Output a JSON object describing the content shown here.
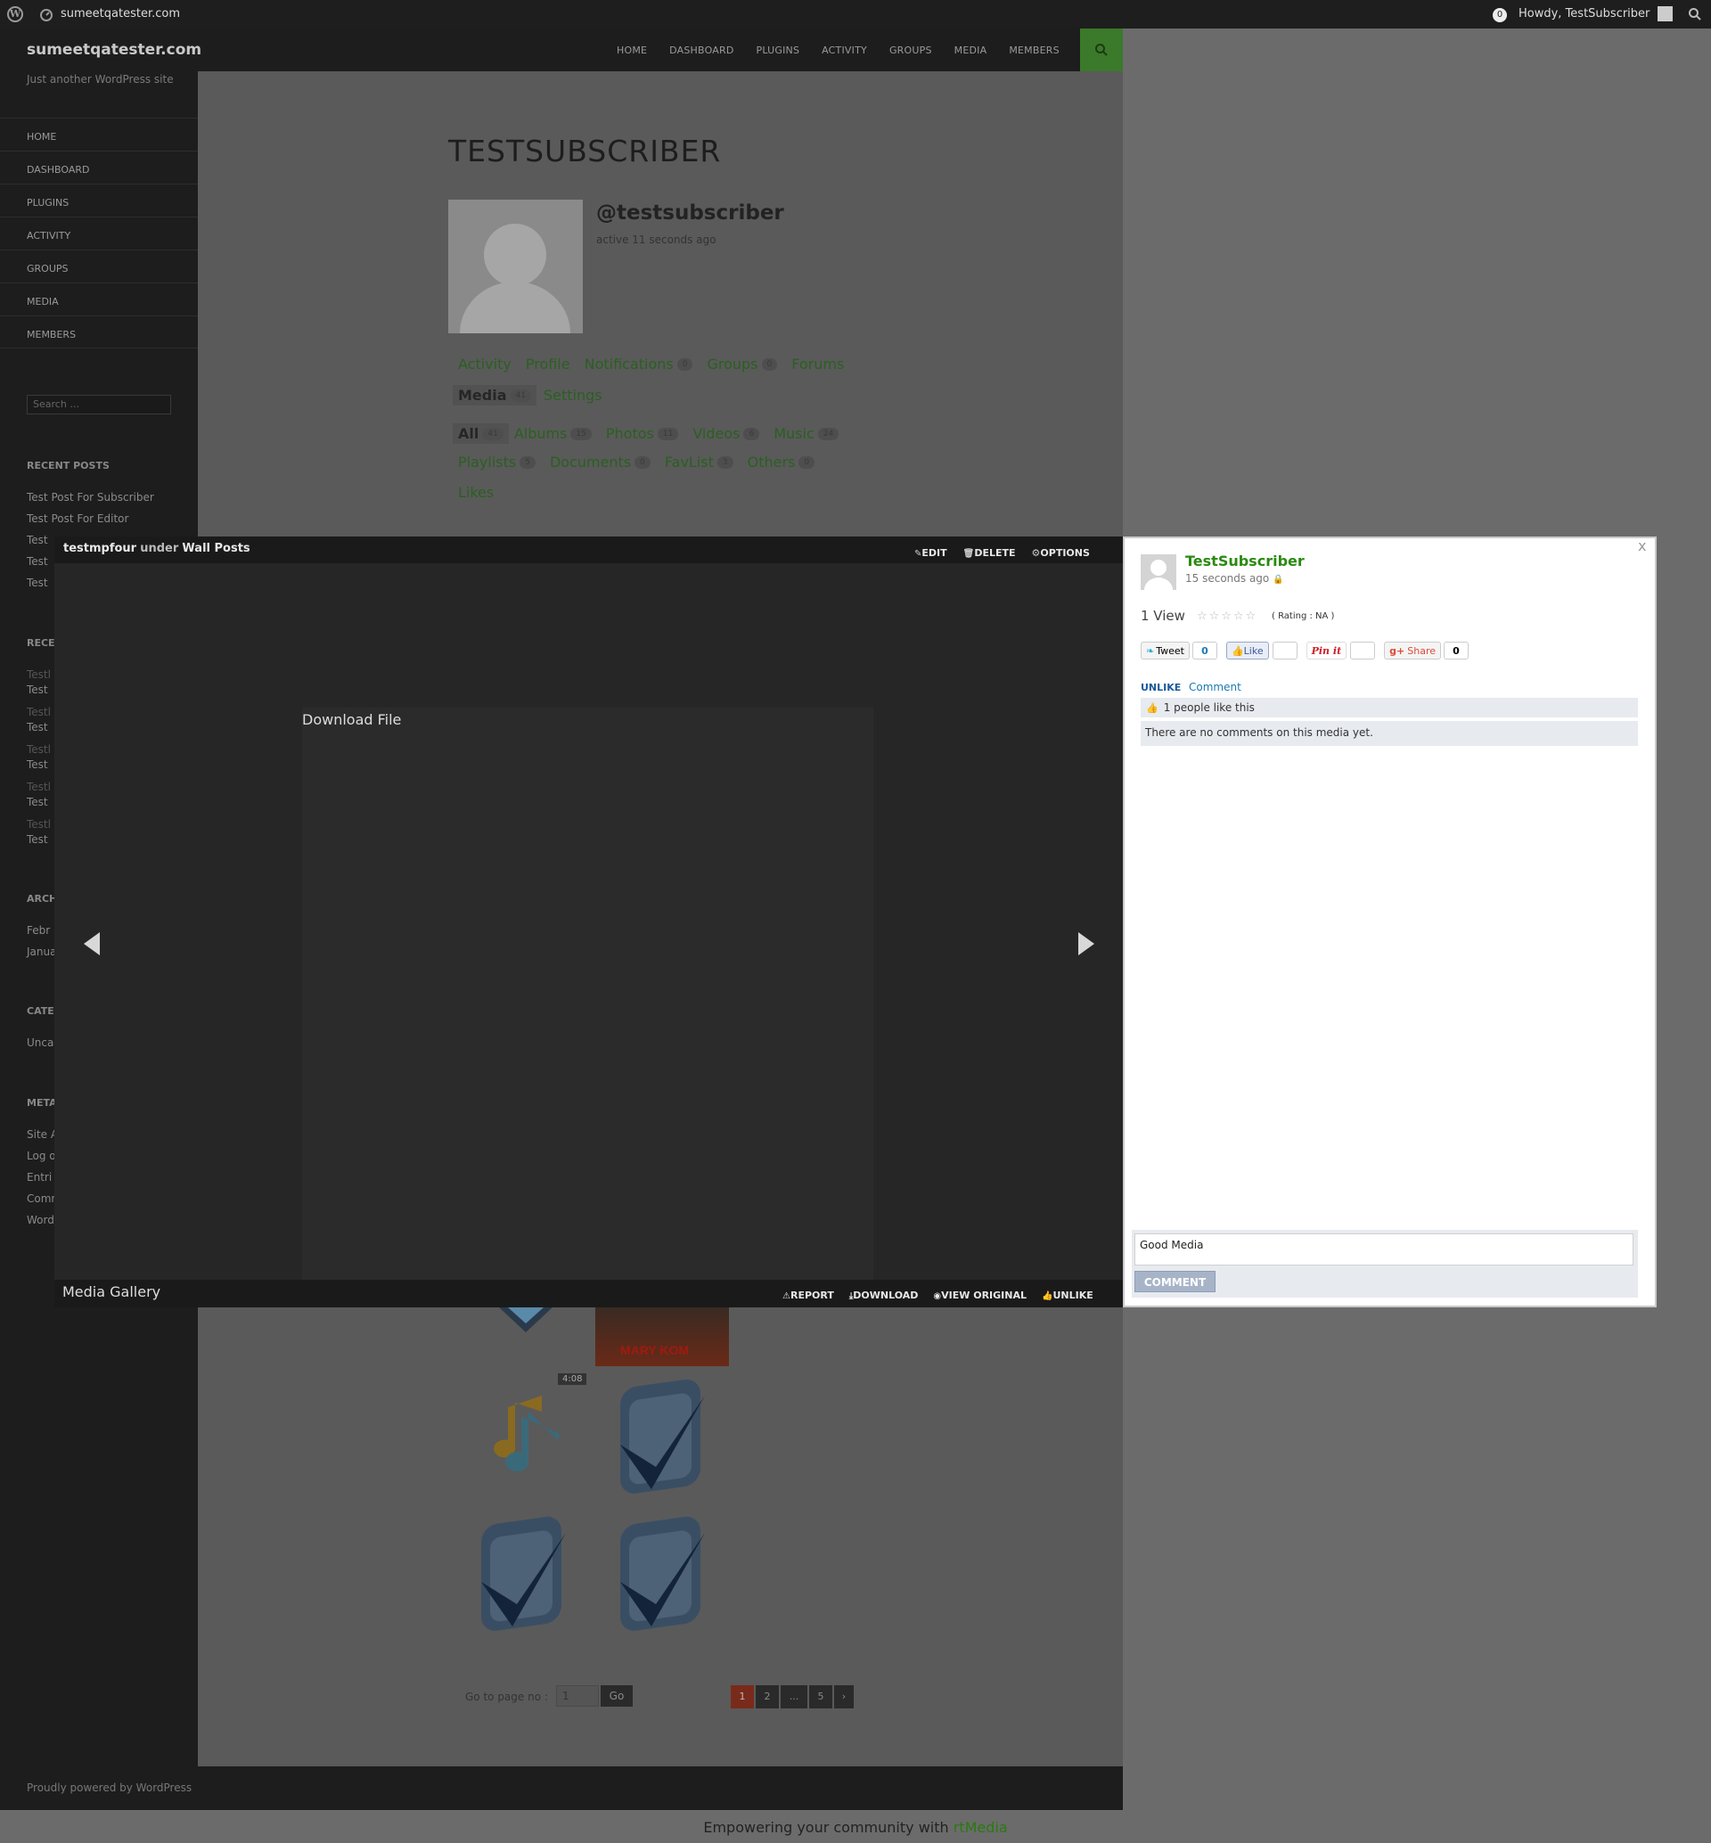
{
  "adminbar": {
    "site_name": "sumeetqatester.com",
    "notif_count": "0",
    "howdy": "Howdy, TestSubscriber"
  },
  "header": {
    "site_title": "sumeetqatester.com",
    "nav": [
      "HOME",
      "DASHBOARD",
      "PLUGINS",
      "ACTIVITY",
      "GROUPS",
      "MEDIA",
      "MEMBERS"
    ]
  },
  "sidebar": {
    "tagline": "Just another WordPress site",
    "nav": [
      "HOME",
      "DASHBOARD",
      "PLUGINS",
      "ACTIVITY",
      "GROUPS",
      "MEDIA",
      "MEMBERS"
    ],
    "search_placeholder": "Search …",
    "recent_posts_title": "RECENT POSTS",
    "recent_posts": [
      "Test Post For Subscriber",
      "Test Post For Editor",
      "Test",
      "Test",
      "Test"
    ],
    "recent_comments_title": "RECE",
    "recent_comments": [
      "Testl",
      "Test",
      "Testl",
      "Test",
      "Testl",
      "Test",
      "Testl",
      "Test",
      "Testl",
      "Test"
    ],
    "archives_title": "ARCH",
    "archives": [
      "Febr",
      "Janua"
    ],
    "categories_title": "CATE",
    "categories": [
      "Unca"
    ],
    "meta_title": "META",
    "meta": [
      "Site A",
      "Log o",
      "Entri",
      "Comm",
      "Word"
    ]
  },
  "profile": {
    "title": "TESTSUBSCRIBER",
    "handle": "@testsubscriber",
    "active": "active 11 seconds ago",
    "tabs": [
      {
        "label": "Activity",
        "count": null
      },
      {
        "label": "Profile",
        "count": null
      },
      {
        "label": "Notifications",
        "count": "0"
      },
      {
        "label": "Groups",
        "count": "0"
      },
      {
        "label": "Forums",
        "count": null
      }
    ],
    "tabs2": [
      {
        "label": "Media",
        "count": "41"
      },
      {
        "label": "Settings",
        "count": null
      }
    ],
    "subtabs": [
      {
        "label": "All",
        "count": "41"
      },
      {
        "label": "Albums",
        "count": "15"
      },
      {
        "label": "Photos",
        "count": "11"
      },
      {
        "label": "Videos",
        "count": "6"
      },
      {
        "label": "Music",
        "count": "24"
      }
    ],
    "subtabs2": [
      {
        "label": "Playlists",
        "count": "5"
      },
      {
        "label": "Documents",
        "count": "0"
      },
      {
        "label": "FavList",
        "count": "3"
      },
      {
        "label": "Others",
        "count": "0"
      }
    ],
    "subtabs3": [
      {
        "label": "Likes",
        "count": null
      }
    ]
  },
  "gallery": {
    "duration": "4:08",
    "poster_text": "MARY KOM",
    "goto_label": "Go to page no :",
    "goto_value": "1",
    "go_button": "Go",
    "pages": [
      "1",
      "2",
      "...",
      "5",
      "›"
    ]
  },
  "footer": {
    "powered": "Proudly powered by WordPress",
    "empower_prefix": "Empowering your community with ",
    "empower_brand": "rtMedia"
  },
  "lightbox": {
    "media_title": "testmpfour",
    "under": "under",
    "album": "Wall Posts",
    "actions": [
      "EDIT",
      "DELETE",
      "OPTIONS"
    ],
    "video_title": "Download File",
    "gallery_label": "Media Gallery",
    "bottom_actions": [
      "REPORT",
      "DOWNLOAD",
      "VIEW ORIGINAL",
      "UNLIKE"
    ],
    "close": "x",
    "user": "TestSubscriber",
    "time": "15 seconds ago",
    "views": "1 View",
    "stars": "☆☆☆☆☆",
    "rating": "( Rating : NA )",
    "tweet": "Tweet",
    "tweet_count": "0",
    "fb_like": "Like",
    "pin": "Pin it",
    "share": "Share",
    "share_count": "0",
    "unlike": "UNLIKE",
    "comment_link": "Comment",
    "likes_text": "1 people like this",
    "no_comments": "There are no comments on this media yet.",
    "comment_value": "Good Media",
    "comment_button": "COMMENT"
  }
}
